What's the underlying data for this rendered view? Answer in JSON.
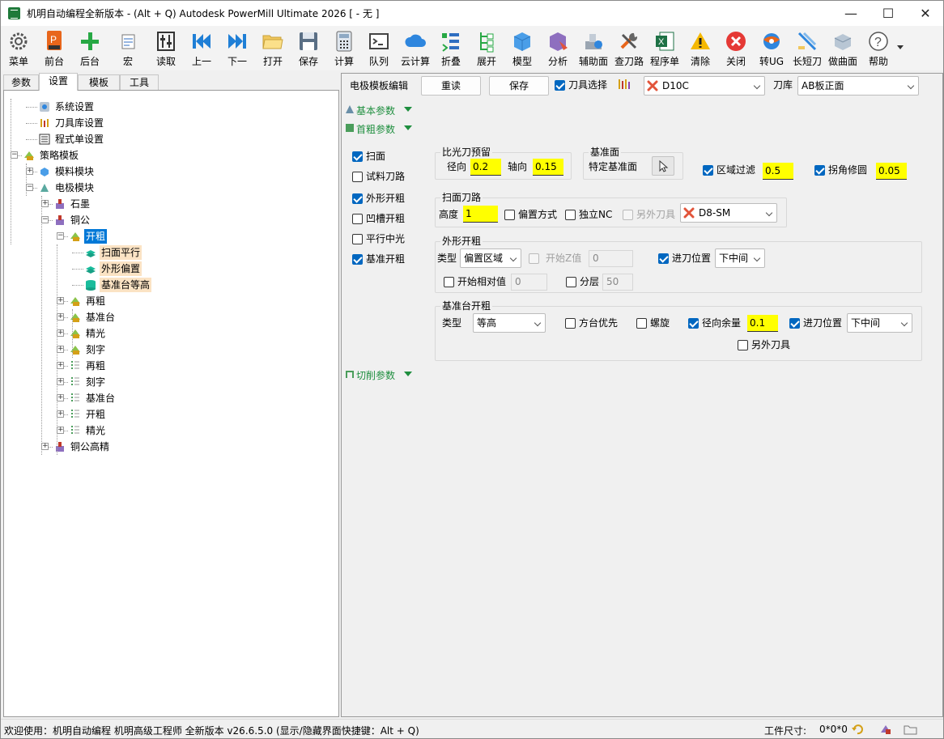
{
  "window": {
    "title": "机明自动编程全新版本 - (Alt + Q) Autodesk PowerMill Ultimate 2026   [ - 无 ]",
    "minimize": "—",
    "maximize": "☐",
    "close": "✕"
  },
  "toolbar": [
    {
      "label": "菜单",
      "icon": "gear-icon"
    },
    {
      "label": "前台",
      "icon": "powermill-icon"
    },
    {
      "label": "后台",
      "icon": "plus-icon"
    },
    {
      "label": "宏",
      "icon": "macro-icon"
    },
    {
      "label": "读取",
      "icon": "sliders-icon"
    },
    {
      "label": "上一",
      "icon": "previous-icon"
    },
    {
      "label": "下一",
      "icon": "next-icon"
    },
    {
      "label": "打开",
      "icon": "folder-icon"
    },
    {
      "label": "保存",
      "icon": "floppy-icon"
    },
    {
      "label": "计算",
      "icon": "calculator-icon"
    },
    {
      "label": "队列",
      "icon": "console-icon"
    },
    {
      "label": "云计算",
      "icon": "cloud-icon"
    },
    {
      "label": "折叠",
      "icon": "collapse-icon"
    },
    {
      "label": "展开",
      "icon": "expand-icon"
    },
    {
      "label": "模型",
      "icon": "cube-icon"
    },
    {
      "label": "分析",
      "icon": "analysis-icon"
    },
    {
      "label": "辅助面",
      "icon": "aux-surface-icon"
    },
    {
      "label": "查刀路",
      "icon": "tools-icon"
    },
    {
      "label": "程序单",
      "icon": "excel-icon"
    },
    {
      "label": "清除",
      "icon": "warning-icon"
    },
    {
      "label": "关闭",
      "icon": "close-circle-icon"
    },
    {
      "label": "转UG",
      "icon": "ug-icon"
    },
    {
      "label": "长短刀",
      "icon": "tool-length-icon"
    },
    {
      "label": "做曲面",
      "icon": "surface-icon"
    },
    {
      "label": "帮助",
      "icon": "help-icon"
    }
  ],
  "left_tabs": [
    "参数",
    "设置",
    "模板",
    "工具"
  ],
  "active_tab": "设置",
  "tree": [
    {
      "label": "系统设置",
      "level": 1,
      "icon": "settings-icon"
    },
    {
      "label": "刀具库设置",
      "level": 1,
      "icon": "tool-library-icon"
    },
    {
      "label": "程式单设置",
      "level": 1,
      "icon": "program-sheet-icon"
    },
    {
      "label": "策略模板",
      "level": 0,
      "icon": "strategy-icon",
      "expand": "−"
    },
    {
      "label": "模料模块",
      "level": 1,
      "icon": "mold-icon",
      "expand": "+"
    },
    {
      "label": "电极模块",
      "level": 1,
      "icon": "electrode-icon",
      "expand": "−"
    },
    {
      "label": "石墨",
      "level": 2,
      "icon": "graphite-icon",
      "expand": "+"
    },
    {
      "label": "铜公",
      "level": 2,
      "icon": "copper-icon",
      "expand": "−"
    },
    {
      "label": "开粗",
      "level": 3,
      "icon": "rough-icon",
      "expand": "−",
      "selected": true
    },
    {
      "label": "扫面平行",
      "level": 4,
      "icon": "layers-icon",
      "hl": true
    },
    {
      "label": "外形偏置",
      "level": 4,
      "icon": "layers-icon",
      "hl": true
    },
    {
      "label": "基准台等高",
      "level": 4,
      "icon": "database-icon",
      "hl": true
    },
    {
      "label": "再粗",
      "level": 3,
      "icon": "rough-icon",
      "expand": "+"
    },
    {
      "label": "基准台",
      "level": 3,
      "icon": "rough-icon",
      "expand": "+"
    },
    {
      "label": "精光",
      "level": 3,
      "icon": "rough-icon",
      "expand": "+"
    },
    {
      "label": "刻字",
      "level": 3,
      "icon": "rough-icon",
      "expand": "+"
    },
    {
      "label": "再粗",
      "level": 3,
      "icon": "list-icon",
      "expand": "+"
    },
    {
      "label": "刻字",
      "level": 3,
      "icon": "list-icon",
      "expand": "+"
    },
    {
      "label": "基准台",
      "level": 3,
      "icon": "list-icon",
      "expand": "+"
    },
    {
      "label": "开粗",
      "level": 3,
      "icon": "list-icon",
      "expand": "+"
    },
    {
      "label": "精光",
      "level": 3,
      "icon": "list-icon",
      "expand": "+"
    },
    {
      "label": "铜公高精",
      "level": 2,
      "icon": "copper-icon",
      "expand": "+"
    }
  ],
  "editor": {
    "title": "电极模板编辑",
    "reload": "重读",
    "save": "保存",
    "tool_select_label": "刀具选择",
    "tool_value": "D10C",
    "library_label": "刀库",
    "library_value": "AB板正面",
    "sections": {
      "basic": "基本参数",
      "first_rough": "首粗参数",
      "cutting": "切削参数"
    },
    "left_checks": [
      {
        "label": "扫面",
        "checked": true
      },
      {
        "label": "试料刀路",
        "checked": false
      },
      {
        "label": "外形开粗",
        "checked": true
      },
      {
        "label": "凹槽开粗",
        "checked": false
      },
      {
        "label": "平行中光",
        "checked": false
      },
      {
        "label": "基准开粗",
        "checked": true
      }
    ],
    "allowance": {
      "title": "比光刀预留",
      "radial_label": "径向",
      "radial_value": "0.2",
      "axial_label": "轴向",
      "axial_value": "0.15"
    },
    "datum": {
      "title": "基准面",
      "label": "特定基准面"
    },
    "region_filter": {
      "label": "区域过滤",
      "checked": true,
      "value": "0.5"
    },
    "corner_fix": {
      "label": "拐角修圆",
      "checked": true,
      "value": "0.05"
    },
    "face_path": {
      "title": "扫面刀路",
      "height_label": "高度",
      "height_value": "1",
      "offset_label": "偏置方式",
      "offset_checked": false,
      "nc_label": "独立NC",
      "nc_checked": false,
      "other_tool_label": "另外刀具",
      "other_tool_checked": false,
      "tool_value": "D8-SM"
    },
    "outline_rough": {
      "title": "外形开粗",
      "type_label": "类型",
      "type_value": "偏置区域",
      "start_z_label": "开始Z值",
      "start_z_checked": false,
      "start_z_value": "0",
      "entry_label": "进刀位置",
      "entry_checked": true,
      "entry_value": "下中间",
      "relative_label": "开始相对值",
      "relative_checked": false,
      "relative_value": "0",
      "layer_label": "分层",
      "layer_checked": false,
      "layer_value": "50"
    },
    "datum_rough": {
      "title": "基准台开粗",
      "type_label": "类型",
      "type_value": "等高",
      "square_label": "方台优先",
      "square_checked": false,
      "spiral_label": "螺旋",
      "spiral_checked": false,
      "radial_label": "径向余量",
      "radial_checked": true,
      "radial_value": "0.1",
      "entry_label": "进刀位置",
      "entry_checked": true,
      "entry_value": "下中间",
      "other_tool_label": "另外刀具",
      "other_tool_checked": false
    }
  },
  "status": {
    "welcome": "欢迎使用：机明自动编程 机明高级工程师 全新版本 v26.6.5.0  (显示/隐藏界面快捷键：Alt + Q)",
    "size_label": "工件尺寸:",
    "size_value": "0*0*0"
  }
}
